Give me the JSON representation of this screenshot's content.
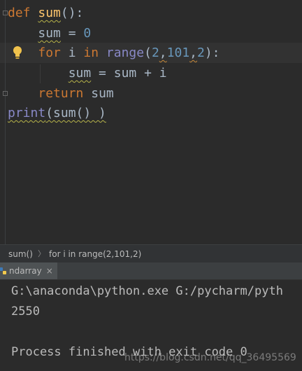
{
  "editor": {
    "line1": {
      "kw": "def",
      "name": "sum",
      "rest": "():"
    },
    "line2": {
      "var": "sum",
      "op": " = ",
      "num": "0"
    },
    "line3": {
      "kw": "for",
      "mid": " i ",
      "kw2": "in",
      "builtin": "range",
      "open": "(",
      "n1": "2",
      "c1": ",",
      "n2": "101",
      "c2": ",",
      "n3": "2",
      "close": "):"
    },
    "line4": {
      "var": "sum",
      "rest": " = sum + i"
    },
    "line5": {
      "kw": "return",
      "rest": " sum"
    },
    "line6": {
      "builtin": "print",
      "rest": "(sum() )"
    }
  },
  "breadcrumb": {
    "item1": "sum()",
    "item2": "for i in range(2,101,2)"
  },
  "run_tab": {
    "label": "ndarray",
    "close": "×"
  },
  "console": {
    "cmd": "G:\\anaconda\\python.exe G:/pycharm/pyth",
    "output": "2550",
    "finished": "Process finished with exit code 0"
  },
  "watermark": "https://blog.csdn.net/qq_36495569",
  "colors": {
    "background": "#2b2b2b",
    "keyword": "#cc7832",
    "function": "#ffc66d",
    "number": "#6897bb",
    "builtin": "#8888c6"
  }
}
